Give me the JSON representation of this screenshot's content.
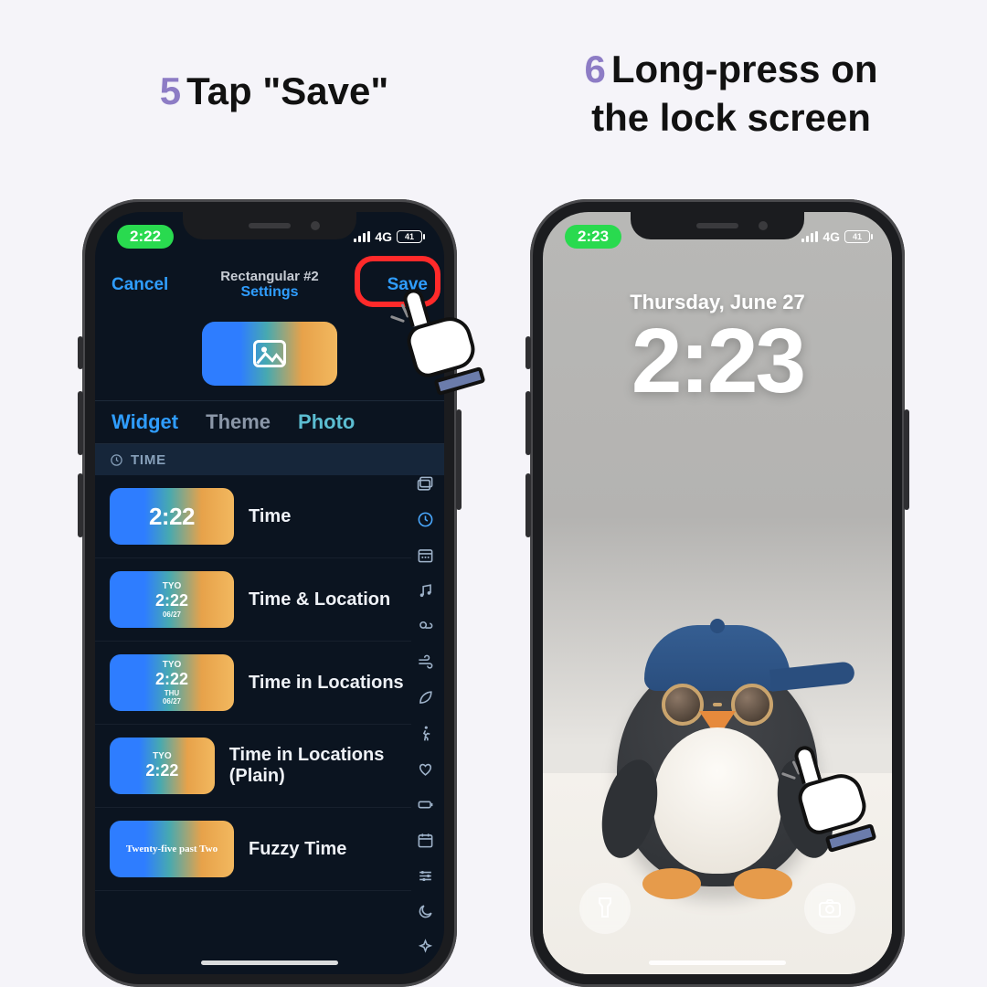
{
  "captions": {
    "left": {
      "num": "5",
      "pre": "Tap ",
      "bold": "\"Save\""
    },
    "right": {
      "num": "6",
      "line1": "Long-press on",
      "line2": "the lock screen"
    }
  },
  "status": {
    "network": "4G",
    "battery": "41"
  },
  "left_phone": {
    "status_time": "2:22",
    "nav": {
      "cancel": "Cancel",
      "title": "Rectangular #2",
      "subtitle": "Settings",
      "save": "Save"
    },
    "tabs": {
      "widget": "Widget",
      "theme": "Theme",
      "photo": "Photo"
    },
    "section": "TIME",
    "rows": [
      {
        "label": "Time",
        "thumb": {
          "style": "big",
          "big": "2:22"
        }
      },
      {
        "label": "Time & Location",
        "thumb": {
          "style": "loc",
          "lbl": "TYO",
          "sm": "2:22",
          "tiny": "06/27"
        }
      },
      {
        "label": "Time in Locations",
        "thumb": {
          "style": "loc2",
          "lbl": "TYO",
          "sm": "2:22",
          "tiny": "THU",
          "tiny2": "06/27"
        }
      },
      {
        "label": "Time in Locations (Plain)",
        "thumb": {
          "style": "plain",
          "lbl": "TYO",
          "sm": "2:22"
        }
      },
      {
        "label": "Fuzzy Time",
        "thumb": {
          "style": "fuzzy",
          "txt": "Twenty-five past Two"
        }
      }
    ],
    "iconrail": [
      "gallery",
      "clock",
      "date",
      "music",
      "weather",
      "wind",
      "leaf",
      "walk",
      "heart",
      "battery",
      "calendar",
      "sliders",
      "moon",
      "sparkle"
    ]
  },
  "right_phone": {
    "status_time": "2:23",
    "date": "Thursday, June 27",
    "time": "2:23"
  }
}
